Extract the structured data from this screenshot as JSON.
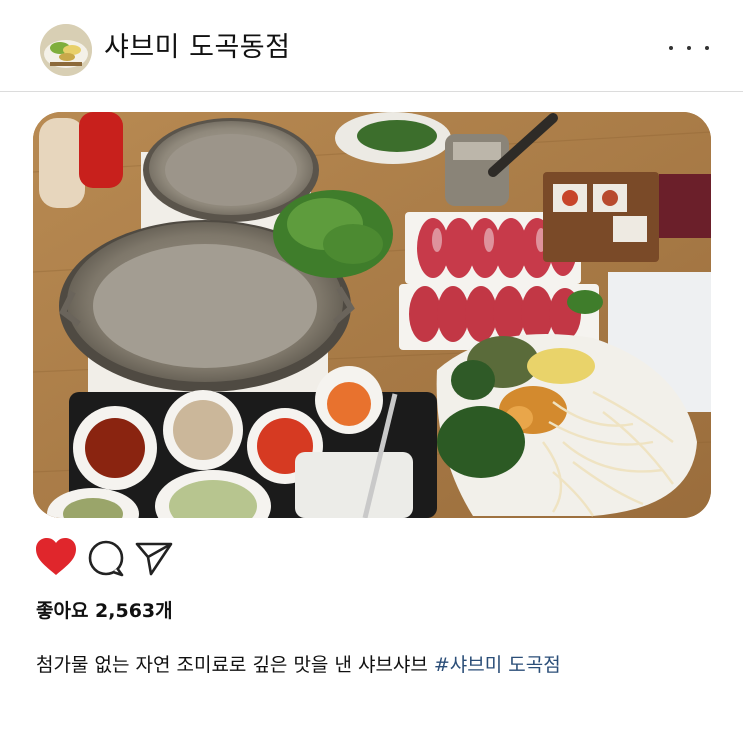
{
  "account": {
    "name": "샤브미 도곡동점"
  },
  "post": {
    "likes_text": "좋아요 2,563개",
    "caption_text": "첨가물 없는 자연 조미료로 깊은 맛을 낸 샤브샤브",
    "hashtag": "#샤브미 도곡점"
  },
  "icons": {
    "more": "more-horizontal-icon",
    "like": "heart-icon",
    "comment": "comment-icon",
    "share": "send-icon"
  },
  "colors": {
    "like_heart": "#e0262c",
    "hashtag": "#2b4e78",
    "divider": "#dcdcdc"
  }
}
